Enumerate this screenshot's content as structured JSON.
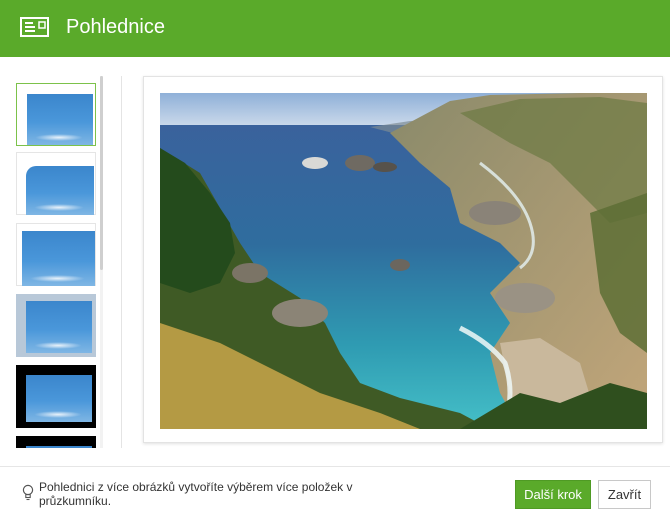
{
  "header": {
    "title": "Pohlednice",
    "icon": "postcard-icon"
  },
  "sidebar": {
    "templates": [
      {
        "style": "plain-white-frame",
        "selected": true
      },
      {
        "style": "rounded-corner-frame",
        "selected": false
      },
      {
        "style": "thin-white-frame",
        "selected": false
      },
      {
        "style": "blurred-frame",
        "selected": false
      },
      {
        "style": "black-frame",
        "selected": false
      },
      {
        "style": "black-frame-alt",
        "selected": false
      }
    ]
  },
  "preview": {
    "image": "coastal-cliffs-photo"
  },
  "footer": {
    "hint_icon": "lightbulb-icon",
    "hint_text": "Pohlednici z více obrázků vytvoříte výběrem více položek v průzkumníku.",
    "next_label": "Další krok",
    "close_label": "Zavřít"
  },
  "colors": {
    "accent": "#5aaa2a",
    "accent_border": "#4f9a24"
  }
}
